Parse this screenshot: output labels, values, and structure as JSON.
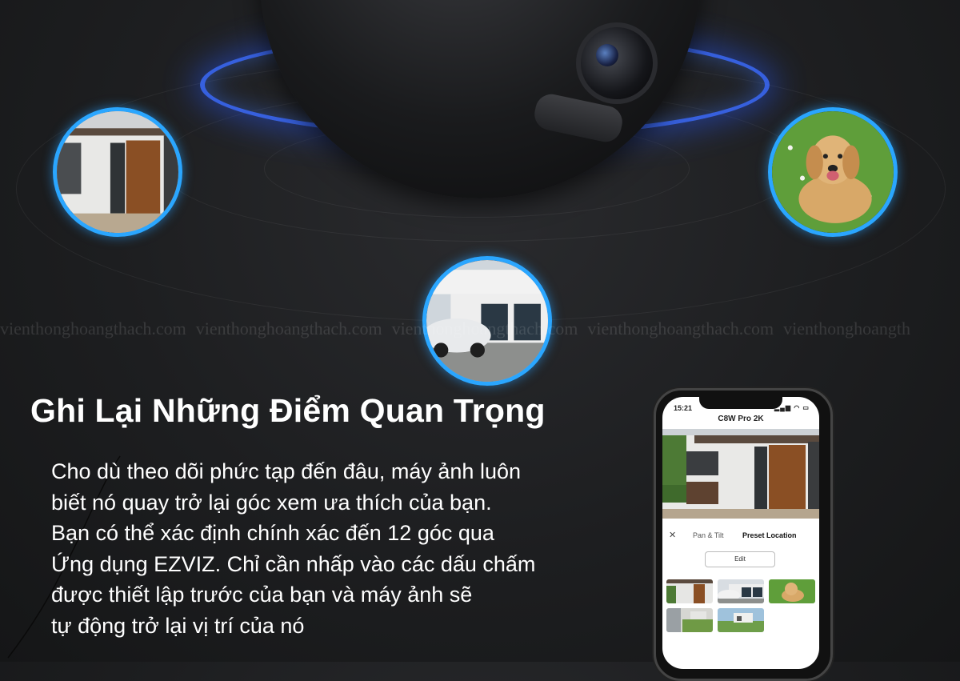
{
  "headline": "Ghi Lại Những Điểm Quan Trọng",
  "body_lines": [
    "Cho dù theo dõi phức tạp đến đâu, máy ảnh luôn",
    "biết nó quay trở lại góc xem ưa thích của bạn.",
    "Bạn có thể xác định chính xác đến 12 góc qua",
    "Ứng dụng EZVIZ. Chỉ cần nhấp vào các dấu chấm",
    "được thiết lập trước của bạn và máy ảnh sẽ",
    "tự động trở lại vị trí của nó"
  ],
  "watermark": [
    "vienthonghoangthach.com",
    "vienthonghoangthach.com",
    "vienthonghoangthach.com",
    "vienthonghoangthach.com",
    "vienthonghoangth"
  ],
  "phone": {
    "status_time": "15:21",
    "status_icons": "▂▄▆ ◠ ▭",
    "app_title": "C8W Pro 2K",
    "close_label": "✕",
    "tab_pan": "Pan & Tilt",
    "tab_preset": "Preset Location",
    "edit_label": "Edit"
  },
  "colors": {
    "accent_ring": "#2aa6ff",
    "glow_blue": "#3b6bff"
  }
}
